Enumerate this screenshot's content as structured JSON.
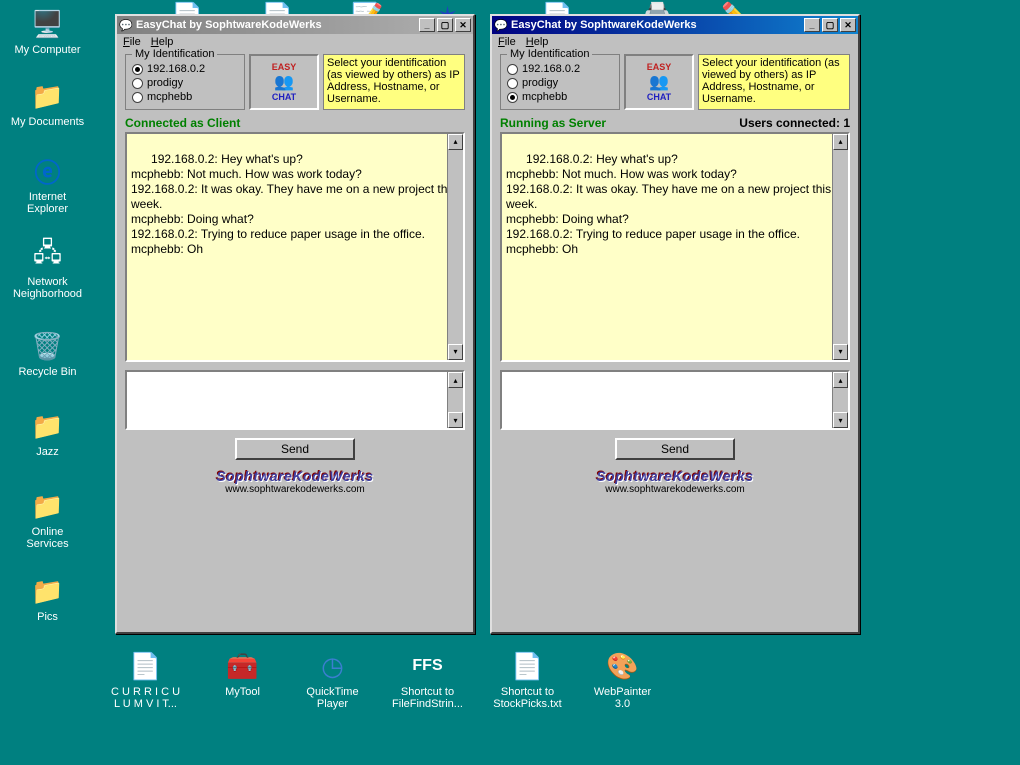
{
  "desktop_icons": {
    "my_computer": "My Computer",
    "my_documents": "My Documents",
    "internet_explorer": "Internet Explorer",
    "network_neighborhood": "Network Neighborhood",
    "recycle_bin": "Recycle Bin",
    "jazz": "Jazz",
    "online_services": "Online Services",
    "pics": "Pics",
    "curriculum": "C U R R I C U L U M  V I T...",
    "mytool": "MyTool",
    "quicktime": "QuickTime Player",
    "shortcut_filefind": "Shortcut to FileFindStrin...",
    "shortcut_stockpicks": "Shortcut to StockPicks.txt",
    "webpainter": "WebPainter 3.0"
  },
  "win1": {
    "title": "EasyChat by SophtwareKodeWerks",
    "menu": {
      "file": "File",
      "help": "Help"
    },
    "group_label": "My Identification",
    "radios": [
      "192.168.0.2",
      "prodigy",
      "mcphebb"
    ],
    "selected": 0,
    "logo_top": "EASY",
    "logo_bottom": "CHAT",
    "hint": "Select your identification (as viewed by others) as IP Address, Hostname, or Username.",
    "status": "Connected as Client",
    "users_label": "",
    "chat": "192.168.0.2: Hey what's up?\nmcphebb: Not much. How was work today?\n192.168.0.2: It was okay. They have me on a new project this week.\nmcphebb: Doing what?\n192.168.0.2: Trying to reduce paper usage in the office.\nmcphebb: Oh",
    "send": "Send",
    "brand": "SophtwareKodeWerks",
    "url": "www.sophtwarekodewerks.com"
  },
  "win2": {
    "title": "EasyChat by SophtwareKodeWerks",
    "menu": {
      "file": "File",
      "help": "Help"
    },
    "group_label": "My Identification",
    "radios": [
      "192.168.0.2",
      "prodigy",
      "mcphebb"
    ],
    "selected": 2,
    "logo_top": "EASY",
    "logo_bottom": "CHAT",
    "hint": "Select your identification (as viewed by others) as IP Address, Hostname, or Username.",
    "status": "Running as Server",
    "users_label": "Users connected: 1",
    "chat": "192.168.0.2: Hey what's up?\nmcphebb: Not much. How was work today?\n192.168.0.2: It was okay. They have me on a new project this week.\nmcphebb: Doing what?\n192.168.0.2: Trying to reduce paper usage in the office.\nmcphebb: Oh",
    "send": "Send",
    "brand": "SophtwareKodeWerks",
    "url": "www.sophtwarekodewerks.com"
  }
}
